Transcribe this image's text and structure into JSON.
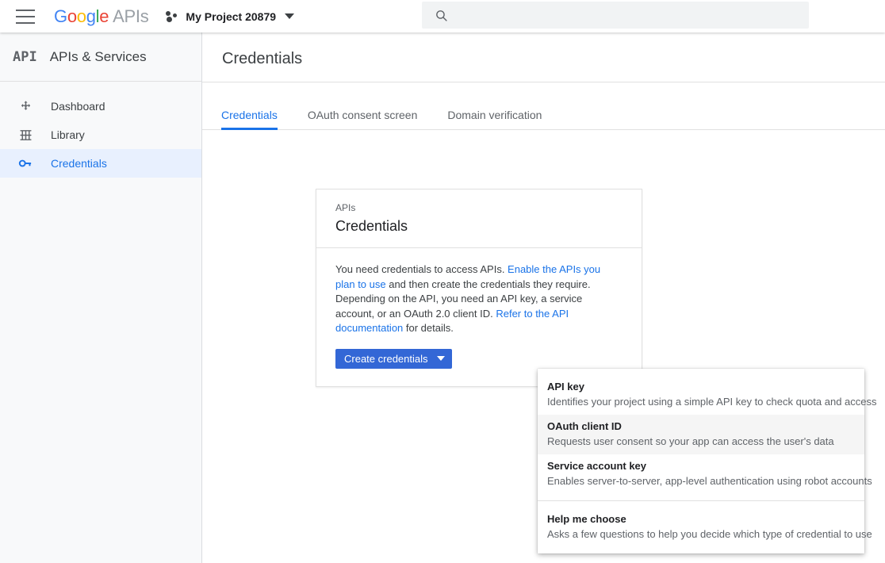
{
  "header": {
    "menu_icon": "hamburger-icon",
    "logo": {
      "google": "Google",
      "product": "APIs",
      "letters": [
        "G",
        "o",
        "o",
        "g",
        "l",
        "e"
      ],
      "colors": [
        "#4285F4",
        "#EA4335",
        "#FBBC05",
        "#4285F4",
        "#34A853",
        "#EA4335"
      ],
      "product_color": "#9aa0a6"
    },
    "project": {
      "name": "My Project 20879",
      "icon": "project-dots-icon",
      "caret": "chevron-down-icon"
    },
    "search": {
      "icon": "search-icon",
      "value": "",
      "placeholder": ""
    }
  },
  "sidebar": {
    "badge": "API",
    "title": "APIs & Services",
    "items": [
      {
        "label": "Dashboard",
        "icon": "dashboard-icon",
        "active": false
      },
      {
        "label": "Library",
        "icon": "library-icon",
        "active": false
      },
      {
        "label": "Credentials",
        "icon": "key-icon",
        "active": true
      }
    ],
    "active_color": "#1a73e8",
    "active_bg": "#e8f0fe"
  },
  "main": {
    "page_title": "Credentials",
    "tabs": [
      {
        "label": "Credentials",
        "active": true
      },
      {
        "label": "OAuth consent screen",
        "active": false
      },
      {
        "label": "Domain verification",
        "active": false
      }
    ]
  },
  "card": {
    "eyebrow": "APIs",
    "title": "Credentials",
    "description": {
      "part1": "You need credentials to access APIs. ",
      "link1": "Enable the APIs you plan to use",
      "part2": " and then create the credentials they require. Depending on the API, you need an API key, a service account, or an OAuth 2.0 client ID. ",
      "link2": "Refer to the API documentation",
      "part3": " for details."
    },
    "button": {
      "label": "Create credentials",
      "caret": "chevron-down-icon",
      "color": "#3367d6"
    }
  },
  "dropdown": {
    "items": [
      {
        "title": "API key",
        "subtitle": "Identifies your project using a simple API key to check quota and access",
        "hover": false
      },
      {
        "title": "OAuth client ID",
        "subtitle": "Requests user consent so your app can access the user's data",
        "hover": true
      },
      {
        "title": "Service account key",
        "subtitle": "Enables server-to-server, app-level authentication using robot accounts",
        "hover": false
      },
      {
        "title": "Help me choose",
        "subtitle": "Asks a few questions to help you decide which type of credential to use",
        "hover": false
      }
    ]
  }
}
